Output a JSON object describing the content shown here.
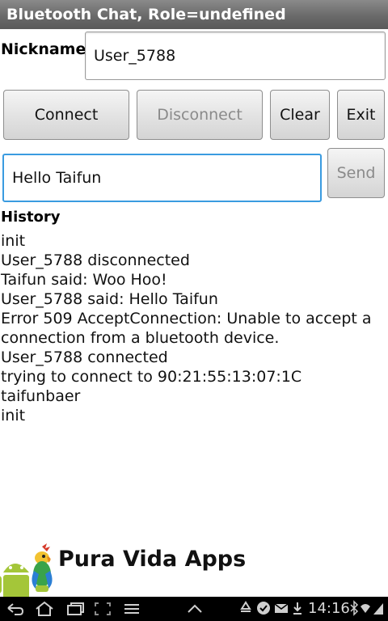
{
  "title": "Bluetooth Chat, Role=undefined",
  "nickname": {
    "label": "Nickname",
    "value": "User_5788"
  },
  "buttons": {
    "connect": "Connect",
    "disconnect": "Disconnect",
    "clear": "Clear",
    "exit": "Exit",
    "send": "Send"
  },
  "message": {
    "value": "Hello Taifun"
  },
  "history": {
    "label": "History",
    "lines": [
      "init",
      "User_5788 disconnected",
      "Taifun said: Woo Hoo!",
      "User_5788 said: Hello Taifun",
      "Error 509 AcceptConnection: Unable to accept a connection from a bluetooth device.",
      "User_5788 connected",
      "trying to connect to 90:21:55:13:07:1C taifunbaer",
      "init"
    ]
  },
  "brand": {
    "name": "Pura Vida Apps"
  },
  "statusbar": {
    "time": "14:16",
    "nav_icons": [
      "back-icon",
      "home-icon",
      "recent-apps-icon",
      "screenshot-icon",
      "menu-icon",
      "chevron-up-icon"
    ],
    "status_icons": [
      "recycle-icon",
      "shield-check-icon",
      "mail-icon",
      "download-icon",
      "bluetooth-icon",
      "wifi-icon",
      "signal-icon"
    ]
  }
}
